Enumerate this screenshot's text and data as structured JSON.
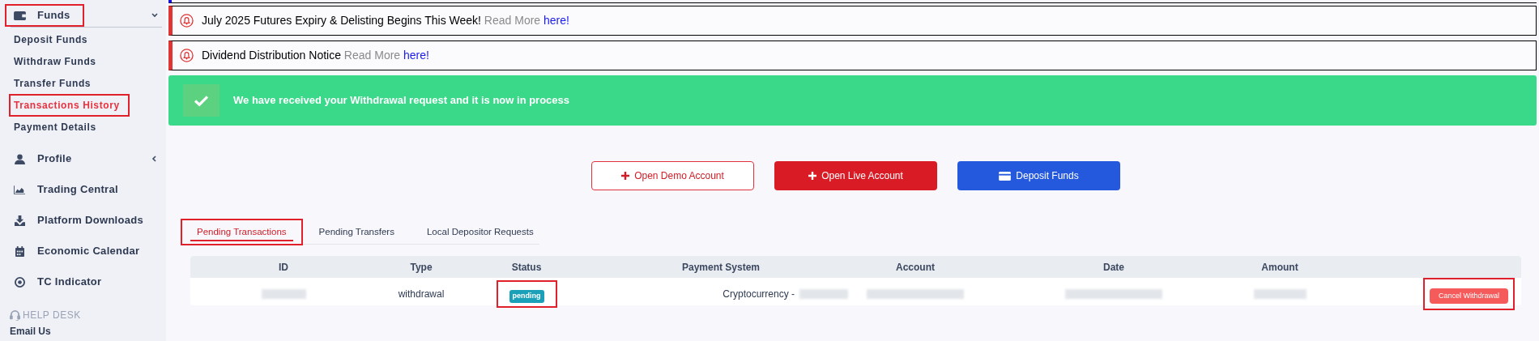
{
  "sidebar": {
    "sections": [
      {
        "label": "Funds",
        "expanded": true,
        "highlighted": true,
        "children": [
          {
            "label": "Deposit Funds",
            "selected": false,
            "highlighted": false
          },
          {
            "label": "Withdraw Funds",
            "selected": false,
            "highlighted": false
          },
          {
            "label": "Transfer Funds",
            "selected": false,
            "highlighted": false
          },
          {
            "label": "Transactions History",
            "selected": true,
            "highlighted": true
          },
          {
            "label": "Payment Details",
            "selected": false,
            "highlighted": false
          }
        ]
      },
      {
        "label": "Profile",
        "expanded": false,
        "highlighted": false
      },
      {
        "label": "Trading Central",
        "highlighted": false
      },
      {
        "label": "Platform Downloads",
        "highlighted": false
      },
      {
        "label": "Economic Calendar",
        "highlighted": false
      },
      {
        "label": "TC Indicator",
        "highlighted": false
      }
    ],
    "help_desk": {
      "title": "HELP DESK",
      "items": [
        "Email Us"
      ]
    }
  },
  "notices": [
    {
      "text": "July 2025 Futures Expiry & Delisting Begins This Week!",
      "more": "Read More",
      "link": "here!"
    },
    {
      "text": "Dividend Distribution Notice",
      "more": "Read More",
      "link": "here!"
    }
  ],
  "alert": {
    "text": "We have received your Withdrawal request and it is now in process"
  },
  "actions": [
    {
      "kind": "outline",
      "label": "Open Demo Account"
    },
    {
      "kind": "danger",
      "label": "Open Live Account"
    },
    {
      "kind": "primary",
      "label": "Deposit Funds"
    }
  ],
  "tabs": [
    {
      "label": "Pending Transactions",
      "selected": true,
      "highlighted": true
    },
    {
      "label": "Pending Transfers",
      "selected": false,
      "highlighted": false
    },
    {
      "label": "Local Depositor Requests",
      "selected": false,
      "highlighted": false
    }
  ],
  "table": {
    "columns": [
      "ID",
      "Type",
      "Status",
      "Payment System",
      "Account",
      "Date",
      "Amount"
    ],
    "rows": [
      {
        "cells": [
          {
            "kind": "redacted"
          },
          {
            "kind": "text",
            "text": "withdrawal"
          },
          {
            "kind": "badge",
            "text": "pending",
            "highlighted": true
          },
          {
            "kind": "text_redacted",
            "text": "Cryptocurrency -"
          },
          {
            "kind": "redacted"
          },
          {
            "kind": "redacted"
          },
          {
            "kind": "redacted"
          }
        ],
        "action": {
          "label": "Cancel Withdrawal",
          "highlighted": true
        }
      }
    ]
  }
}
